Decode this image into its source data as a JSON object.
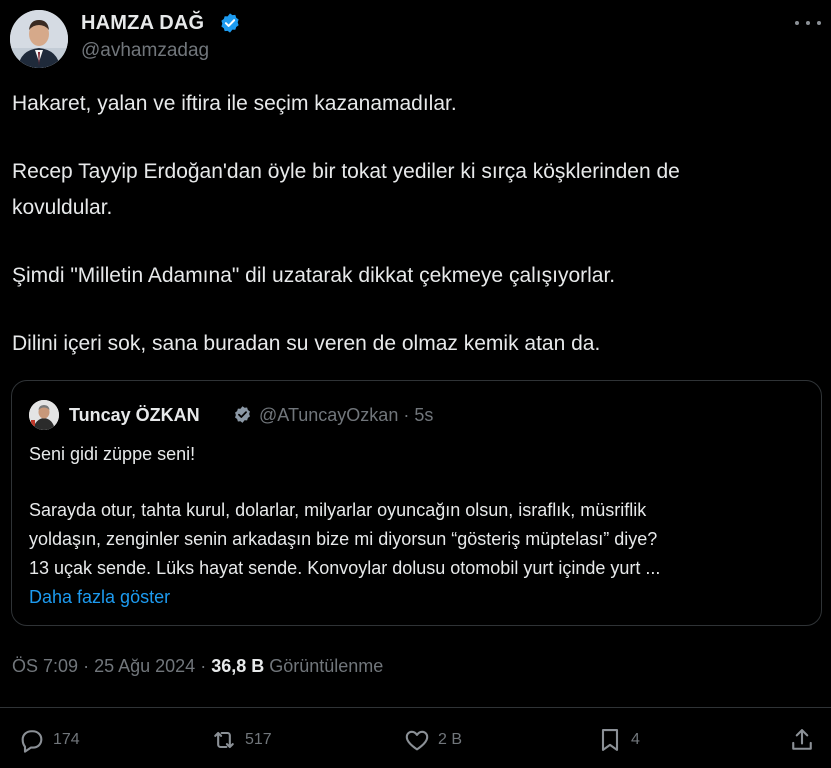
{
  "author": {
    "name": "HAMZA DAĞ",
    "handle": "@avhamzadag"
  },
  "tweet": {
    "lines": [
      "Hakaret, yalan ve iftira ile seçim kazanamadılar.",
      "Recep Tayyip Erdoğan'dan öyle bir tokat yediler ki sırça köşklerinden de",
      "kovuldular.",
      "Şimdi \"Milletin Adamına\" dil uzatarak dikkat çekmeye çalışıyorlar.",
      "Dilini içeri sok, sana buradan su veren de olmaz kemik atan da."
    ]
  },
  "quote": {
    "name": "Tuncay ÖZKAN",
    "handle_time": "@ATuncayOzkan · 5s",
    "lines": [
      "Seni gidi züppe seni!",
      "Sarayda otur, tahta kurul, dolarlar, milyarlar oyuncağın olsun, israflık, müsriflik",
      "yoldaşın, zenginler senin arkadaşın bize mi diyorsun “gösteriş müptelası” diye?",
      "13 uçak sende. Lüks hayat sende. Konvoylar dolusu otomobil yurt içinde yurt ..."
    ],
    "show_more": "Daha fazla göster"
  },
  "meta": {
    "time": "ÖS 7:09",
    "date": "25 Ağu 2024",
    "views": "36,8 B",
    "views_label": "Görüntülenme"
  },
  "actions": {
    "replies": "174",
    "retweets": "517",
    "likes": "2 B",
    "bookmarks": "4"
  },
  "colors": {
    "background": "#000000",
    "text": "#e7e9ea",
    "muted": "#71767b",
    "accent": "#1d9bf0",
    "border": "#2f3336"
  },
  "icons": {
    "verified": "verified-badge-icon",
    "more": "more-options-icon",
    "reply": "reply-icon",
    "retweet": "retweet-icon",
    "like": "heart-icon",
    "bookmark": "bookmark-icon",
    "share": "share-icon"
  }
}
